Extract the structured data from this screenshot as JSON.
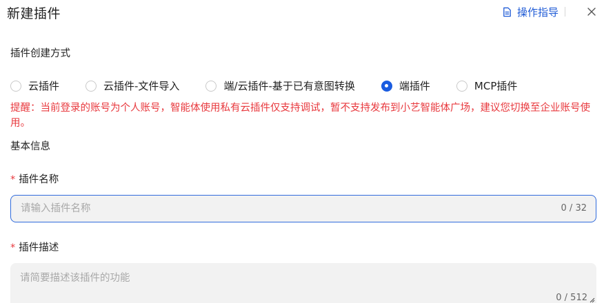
{
  "header": {
    "title": "新建插件",
    "guide_label": "操作指导",
    "guide_icon": "document-icon",
    "close_icon": "close-icon"
  },
  "creation": {
    "label": "插件创建方式",
    "options": [
      {
        "label": "云插件",
        "selected": false
      },
      {
        "label": "云插件-文件导入",
        "selected": false
      },
      {
        "label": "端/云插件-基于已有意图转换",
        "selected": false
      },
      {
        "label": "端插件",
        "selected": true
      },
      {
        "label": "MCP插件",
        "selected": false
      }
    ],
    "warning": "提醒：当前登录的账号为个人账号，智能体使用私有云插件仅支持调试，暂不支持发布到小艺智能体广场，建议您切换至企业账号使用。"
  },
  "basic_info": {
    "label": "基本信息",
    "required_mark": "*",
    "name_field": {
      "label": "插件名称",
      "placeholder": "请输入插件名称",
      "value": "",
      "counter": "0 / 32"
    },
    "desc_field": {
      "label": "插件描述",
      "placeholder": "请简要描述该插件的功能",
      "value": "",
      "counter": "0 / 512"
    }
  },
  "colors": {
    "accent": "#1a5ce0",
    "warning": "#e8383d",
    "field_bg": "#f2f2f2"
  }
}
